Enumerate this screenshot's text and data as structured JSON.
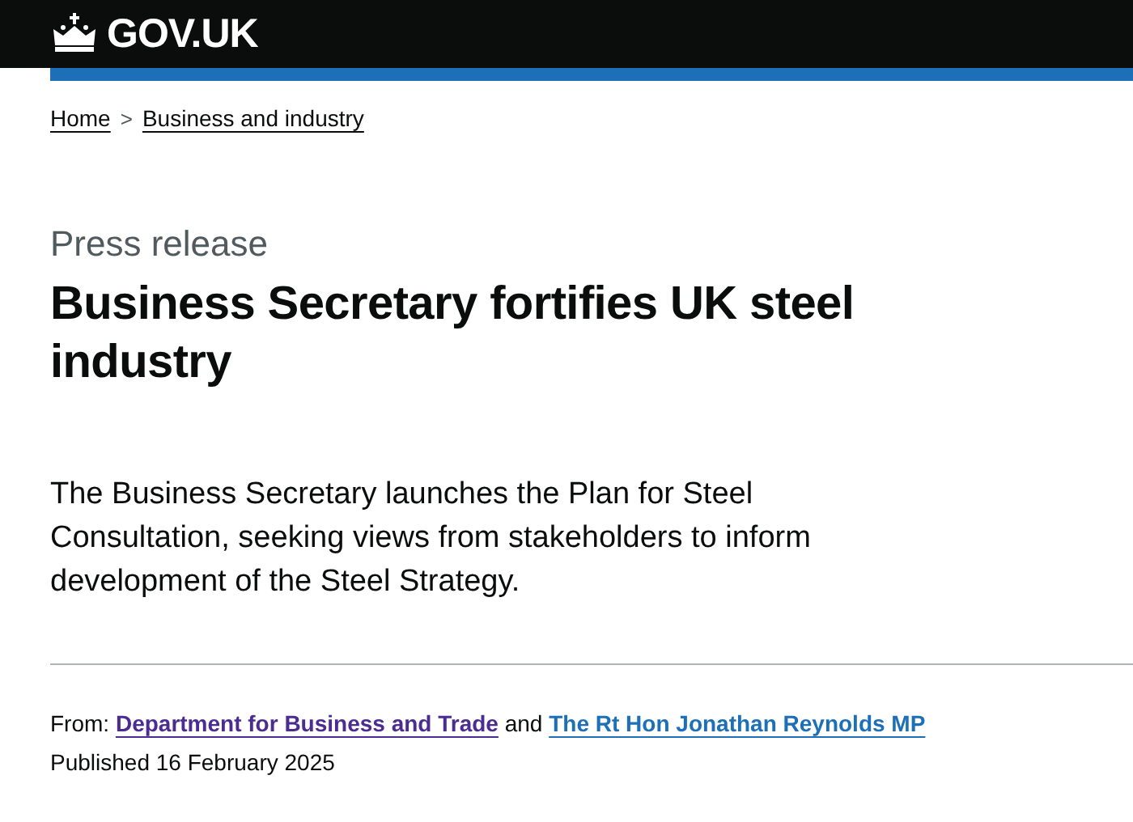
{
  "header": {
    "logo_text": "GOV.UK"
  },
  "breadcrumbs": [
    {
      "label": "Home",
      "separator": ">"
    },
    {
      "label": "Business and industry"
    }
  ],
  "document_type": "Press release",
  "title": "Business Secretary fortifies UK steel industry",
  "lead": "The Business Secretary launches the Plan for Steel Consultation, seeking views from stakeholders to inform development of the Steel Strategy.",
  "metadata": {
    "from_label": "From:",
    "joiner": "and",
    "organisations": [
      {
        "name": "Department for Business and Trade",
        "visited": true
      },
      {
        "name": "The Rt Hon Jonathan Reynolds MP",
        "visited": false
      }
    ],
    "published": "Published 16 February 2025"
  }
}
